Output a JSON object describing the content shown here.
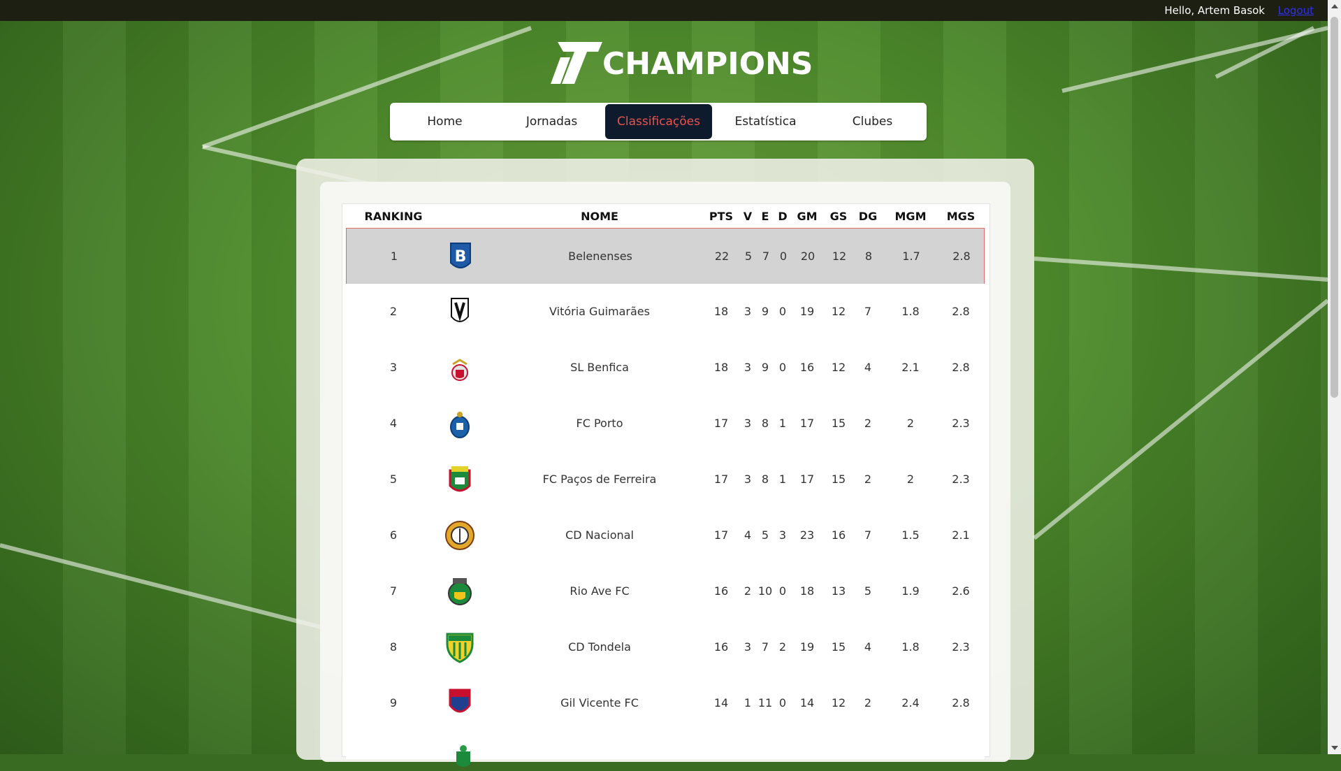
{
  "user_bar": {
    "greeting": "Hello, Artem Basok",
    "logout_label": "Logout"
  },
  "brand": {
    "name": "CHAMPIONS"
  },
  "nav": {
    "tabs": [
      {
        "label": "Home"
      },
      {
        "label": "Jornadas"
      },
      {
        "label": "Classificações"
      },
      {
        "label": "Estatística"
      },
      {
        "label": "Clubes"
      }
    ],
    "active": "Classificações"
  },
  "table": {
    "headers": {
      "ranking": "RANKING",
      "nome": "NOME",
      "pts": "PTS",
      "v": "V",
      "e": "E",
      "d": "D",
      "gm": "GM",
      "gs": "GS",
      "dg": "DG",
      "mgm": "MGM",
      "mgs": "MGS"
    },
    "rows": [
      {
        "rank": "1",
        "name": "Belenenses",
        "pts": "22",
        "v": "5",
        "e": "7",
        "d": "0",
        "gm": "20",
        "gs": "12",
        "dg": "8",
        "mgm": "1.7",
        "mgs": "2.8",
        "crest": "belenenses-crest-icon"
      },
      {
        "rank": "2",
        "name": "Vitória Guimarães",
        "pts": "18",
        "v": "3",
        "e": "9",
        "d": "0",
        "gm": "19",
        "gs": "12",
        "dg": "7",
        "mgm": "1.8",
        "mgs": "2.8",
        "crest": "vitoria-guimaraes-crest-icon"
      },
      {
        "rank": "3",
        "name": "SL Benfica",
        "pts": "18",
        "v": "3",
        "e": "9",
        "d": "0",
        "gm": "16",
        "gs": "12",
        "dg": "4",
        "mgm": "2.1",
        "mgs": "2.8",
        "crest": "benfica-crest-icon"
      },
      {
        "rank": "4",
        "name": "FC Porto",
        "pts": "17",
        "v": "3",
        "e": "8",
        "d": "1",
        "gm": "17",
        "gs": "15",
        "dg": "2",
        "mgm": "2",
        "mgs": "2.3",
        "crest": "porto-crest-icon"
      },
      {
        "rank": "5",
        "name": "FC Paços de Ferreira",
        "pts": "17",
        "v": "3",
        "e": "8",
        "d": "1",
        "gm": "17",
        "gs": "15",
        "dg": "2",
        "mgm": "2",
        "mgs": "2.3",
        "crest": "pacos-ferreira-crest-icon"
      },
      {
        "rank": "6",
        "name": "CD Nacional",
        "pts": "17",
        "v": "4",
        "e": "5",
        "d": "3",
        "gm": "23",
        "gs": "16",
        "dg": "7",
        "mgm": "1.5",
        "mgs": "2.1",
        "crest": "nacional-crest-icon"
      },
      {
        "rank": "7",
        "name": "Rio Ave FC",
        "pts": "16",
        "v": "2",
        "e": "10",
        "d": "0",
        "gm": "18",
        "gs": "13",
        "dg": "5",
        "mgm": "1.9",
        "mgs": "2.6",
        "crest": "rio-ave-crest-icon"
      },
      {
        "rank": "8",
        "name": "CD Tondela",
        "pts": "16",
        "v": "3",
        "e": "7",
        "d": "2",
        "gm": "19",
        "gs": "15",
        "dg": "4",
        "mgm": "1.8",
        "mgs": "2.3",
        "crest": "tondela-crest-icon"
      },
      {
        "rank": "9",
        "name": "Gil Vicente FC",
        "pts": "14",
        "v": "1",
        "e": "11",
        "d": "0",
        "gm": "14",
        "gs": "12",
        "dg": "2",
        "mgm": "2.4",
        "mgs": "2.8",
        "crest": "gil-vicente-crest-icon"
      }
    ]
  },
  "colors": {
    "nav_active_bg": "#0e1b2d",
    "nav_active_text": "#e8534f",
    "selected_row_bg": "#d3d3d3",
    "selected_row_border": "#e26b6b",
    "logout_link": "#2f2ff0"
  }
}
